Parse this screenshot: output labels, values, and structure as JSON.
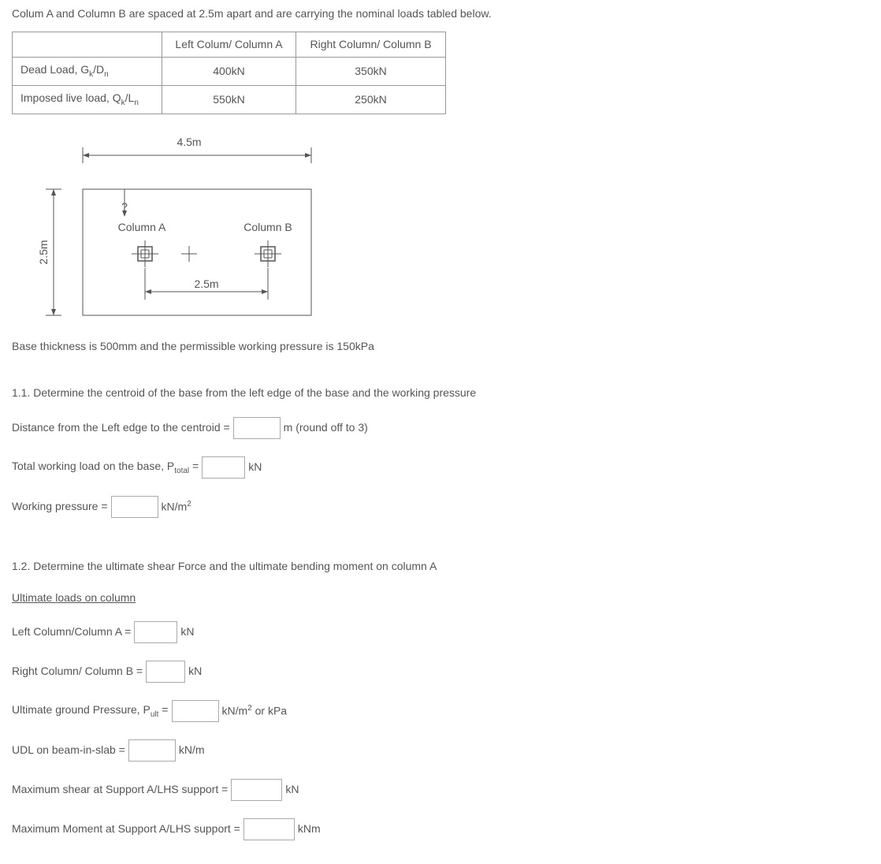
{
  "intro": "Colum A and Column B are spaced at 2.5m apart and are carrying the nominal loads tabled below.",
  "table": {
    "header_left": "Left Colum/ Column A",
    "header_right": "Right Column/ Column B",
    "row1_label_prefix": "Dead Load, G",
    "row1_sub1": "k",
    "row1_mid": "/D",
    "row1_sub2": "n",
    "row1_left": "400kN",
    "row1_right": "350kN",
    "row2_label_prefix": "Imposed live load, Q",
    "row2_sub1": "k",
    "row2_mid": "/L",
    "row2_sub2": "n",
    "row2_left": "550kN",
    "row2_right": "250kN"
  },
  "diagram": {
    "top_dim": "4.5m",
    "left_dim": "2.5m",
    "bottom_dim": "2.5m",
    "unknown": "?",
    "colA": "Column A",
    "colB": "Column B"
  },
  "base_note": "Base thickness is 500mm and the permissible working pressure is 150kPa",
  "q11_title": "1.1.  Determine the centroid of the base from the left edge of the base and the working pressure",
  "q11_line1_pre": "Distance from the Left edge to the centroid =",
  "q11_line1_post": "m (round off to 3)",
  "q11_line2_pre": "Total working load on the base, P",
  "q11_line2_sub": "total",
  "q11_line2_eq": " =",
  "q11_line2_post": "kN",
  "q11_line3_pre": "Working pressure =",
  "q11_line3_post_pre": "kN/m",
  "q11_line3_post_sup": "2",
  "q12_title": "1.2.  Determine the ultimate shear Force and the ultimate bending moment on column A",
  "q12_heading": "Ultimate loads on column",
  "q12_line1_pre": "Left Column/Column A  =",
  "q12_line1_post": "kN",
  "q12_line2_pre": "Right Column/ Column B  =",
  "q12_line2_post": "kN",
  "q12_line3_pre": "Ultimate ground Pressure, P",
  "q12_line3_sub": "ult",
  "q12_line3_eq": " =",
  "q12_line3_post_pre": "kN/m",
  "q12_line3_post_sup": "2",
  "q12_line3_post_suffix": " or kPa",
  "q12_line4_pre": "UDL on beam-in-slab =",
  "q12_line4_post": "kN/m",
  "q12_line5_pre": "Maximum shear at Support A/LHS support =",
  "q12_line5_post": "kN",
  "q12_line6_pre": "Maximum Moment at Support A/LHS support =",
  "q12_line6_post": "kNm"
}
